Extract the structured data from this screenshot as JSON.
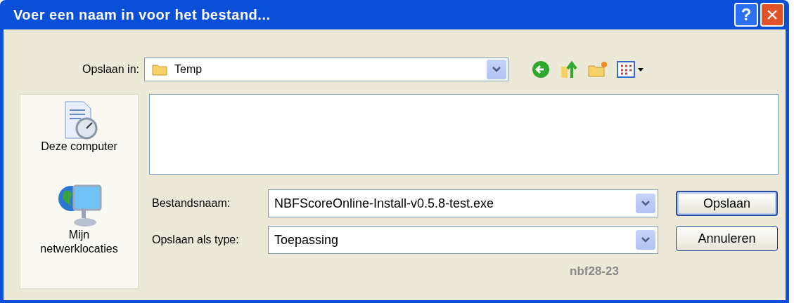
{
  "window": {
    "title": "Voer een naam in voor het bestand...",
    "help_button": "?",
    "close_button": "×"
  },
  "save_in": {
    "label": "Opslaan in:",
    "value": "Temp"
  },
  "places": [
    {
      "label": "Deze computer",
      "kind": "computer"
    },
    {
      "label": "Mijn netwerklocaties",
      "kind": "network"
    }
  ],
  "fields": [
    {
      "label": "Bestandsnaam:",
      "value": "NBFScoreOnline-Install-v0.5.8-test.exe"
    },
    {
      "label": "Opslaan als type:",
      "value": "Toepassing"
    }
  ],
  "buttons": [
    {
      "label": "Opslaan",
      "default": true
    },
    {
      "label": "Annuleren",
      "default": false
    }
  ],
  "figure_label": "nbf28-23"
}
